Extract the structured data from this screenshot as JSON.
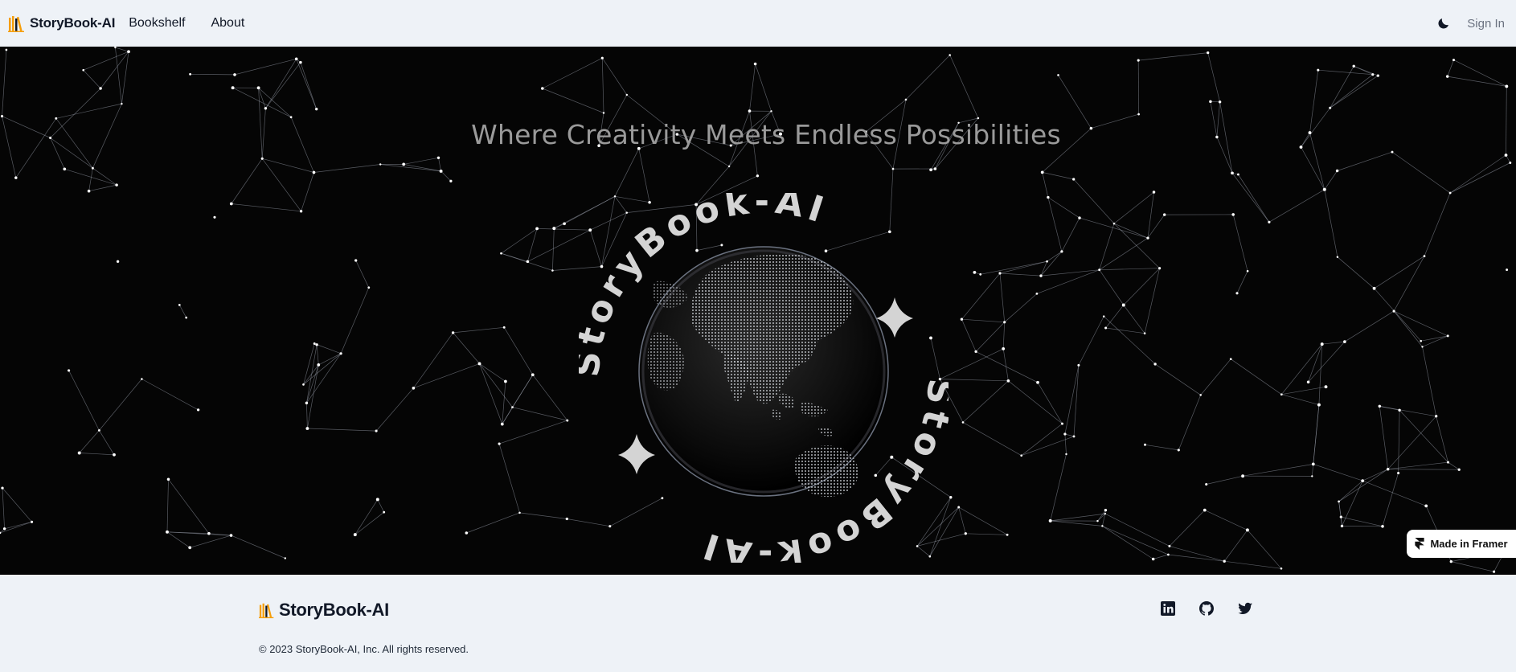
{
  "nav": {
    "brand": "StoryBook-AI",
    "links": [
      {
        "label": "Bookshelf"
      },
      {
        "label": "About"
      }
    ],
    "sign_in": "Sign In",
    "theme_icon": "moon-icon"
  },
  "hero": {
    "tagline": "Where Creativity Meets Endless Possibilities",
    "ring_text": "StoryBook-AI",
    "badge": "Made in Framer",
    "background_color": "#050505"
  },
  "footer": {
    "brand": "StoryBook-AI",
    "copyright": "© 2023 StoryBook-AI, Inc. All rights reserved.",
    "social": [
      "linkedin-icon",
      "github-icon",
      "twitter-icon"
    ]
  },
  "colors": {
    "accent": "#f59e0b",
    "text": "#111827",
    "muted": "#6b7280"
  }
}
